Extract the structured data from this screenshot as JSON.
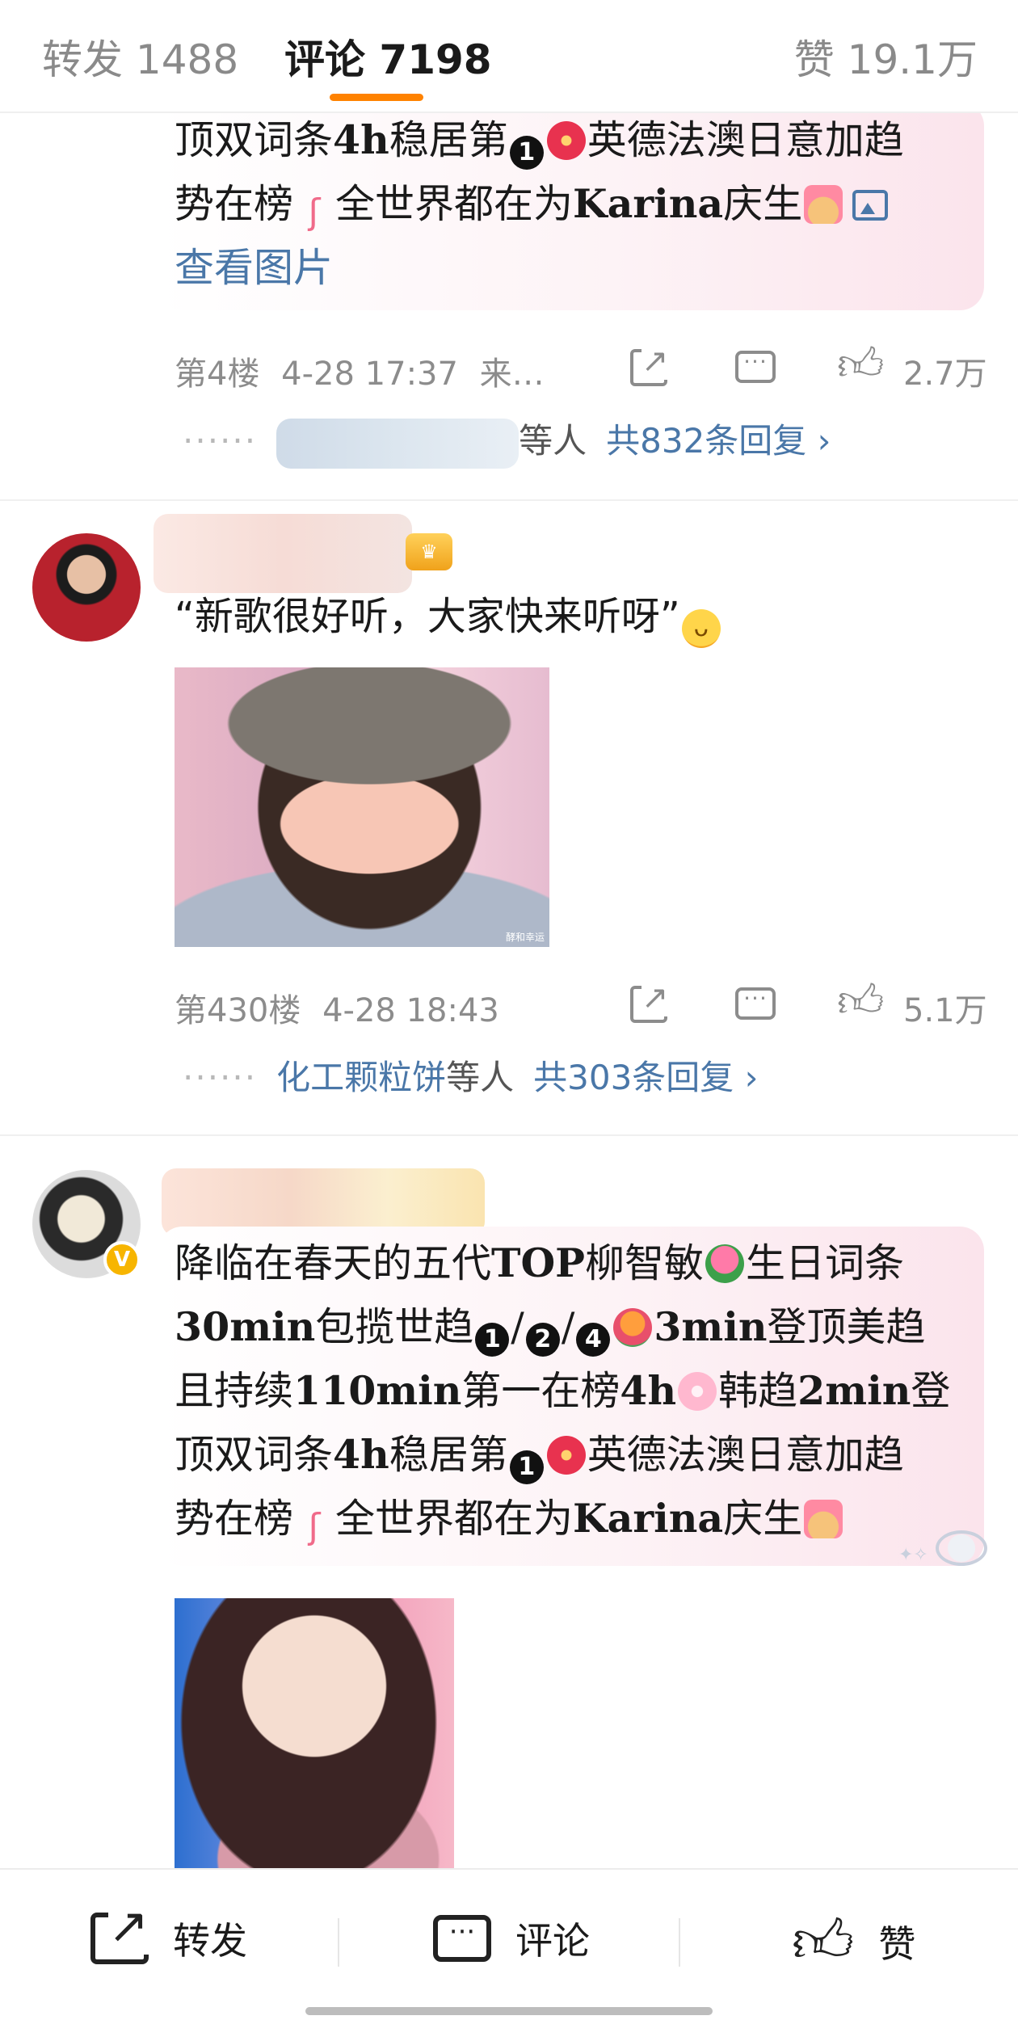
{
  "tabs": {
    "repost": "转发 1488",
    "comment": "评论 7198",
    "like": "赞 19.1万"
  },
  "comment1": {
    "lines": [
      "顶双词条",
      "4h",
      "稳居第",
      "英德法澳日意加趋",
      "势在榜",
      "全世界都在为",
      "Karina",
      "庆生"
    ],
    "view_image": "查看图片",
    "floor": "第4楼",
    "time": "4-28 17:37",
    "source": "来…",
    "likes": "2.7万",
    "reply_suffix": "等人",
    "reply_total": "共832条回复 ›"
  },
  "comment2": {
    "text": "“新歌很好听，大家快来听呀”",
    "photo_watermark": "酵和幸运",
    "floor": "第430楼",
    "time": "4-28 18:43",
    "likes": "5.1万",
    "reply_user": "化工颗粒饼",
    "reply_suffix": "等人",
    "reply_total": "共303条回复 ›"
  },
  "comment3": {
    "l1": "降临在春天的五代",
    "l1b": "TOP",
    "l1c": "柳智敏",
    "l1d": "生日词条",
    "l2a": "30min",
    "l2b": "包揽世趋",
    "l2c": "/",
    "l2d": "/",
    "l2e": "3min",
    "l2f": "登顶美趋",
    "l3a": "且持续",
    "l3b": "110min",
    "l3c": "第一在榜",
    "l3d": "4h",
    "l3e": "韩趋",
    "l3f": "2min",
    "l3g": "登",
    "l4a": "顶双词条",
    "l4b": "4h",
    "l4c": "稳居第",
    "l4d": "英德法澳日意加趋",
    "l5a": "势在榜",
    "l5b": "全世界都在为",
    "l5c": "Karina",
    "l5d": "庆生"
  },
  "emoji": {
    "one": "1",
    "two": "2",
    "four": "4"
  },
  "bottom": {
    "share": "转发",
    "comment": "评论",
    "like": "赞"
  },
  "colors": {
    "accent": "#ff8200",
    "link": "#4a77a8",
    "meta": "#8c8c8c"
  }
}
